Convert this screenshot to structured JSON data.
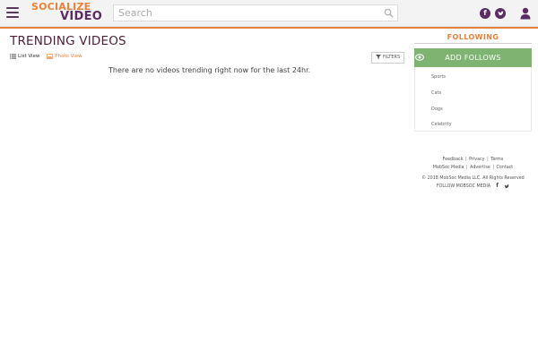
{
  "header": {
    "logo_line1": "SOCIALIZE",
    "logo_line2": "VIDEO",
    "search_placeholder": "Search",
    "facebook_glyph": "f",
    "brand_color": "#5b2b63",
    "accent_color": "#e8823a"
  },
  "main": {
    "title": "TRENDING VIDEOS",
    "list_view_label": "List View",
    "photo_view_label": "Photo View",
    "filters_label": "FILTERS",
    "empty_message": "There are no videos trending right now for the last 24hr."
  },
  "sidebar": {
    "following_title": "FOLLOWING",
    "add_follows_label": "ADD FOLLOWS",
    "add_follows_color": "#7fb371",
    "items": [
      "Sports",
      "Cats",
      "Dogs",
      "Celebrity"
    ]
  },
  "footer": {
    "links_row1": [
      "Feedback",
      "Privacy",
      "Terms"
    ],
    "links_row2": [
      "MobSoc Media",
      "Advertise",
      "Contact"
    ],
    "separator": "|",
    "copyright": "© 2018 MobSoc Media LLC. All Rights Reserved",
    "follow_label": "FOLLOW MOBSOC MEDIA",
    "facebook_glyph": "f"
  }
}
